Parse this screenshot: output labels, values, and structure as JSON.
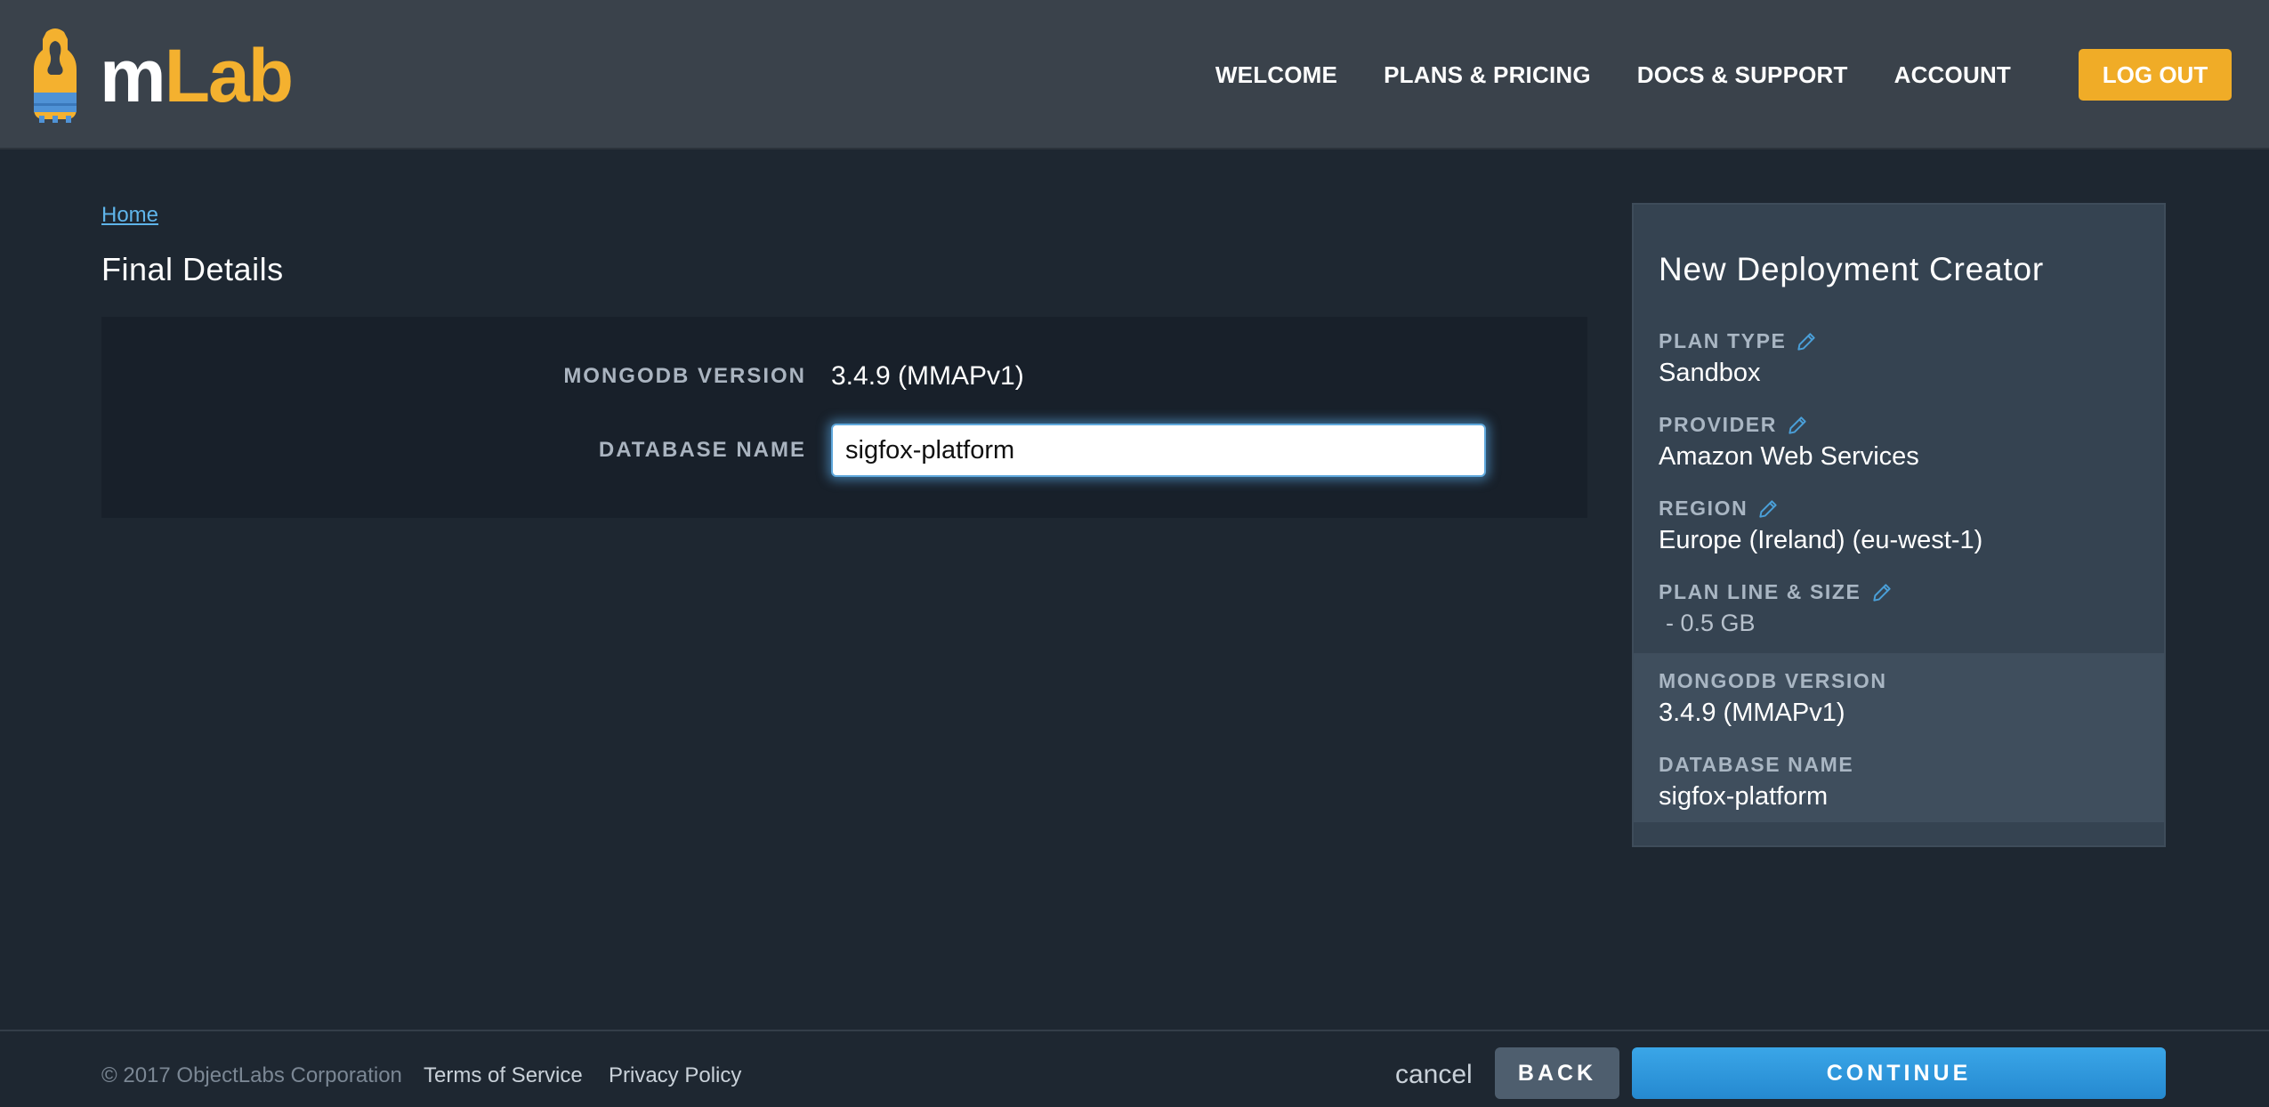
{
  "header": {
    "logo": {
      "text_m": "m",
      "text_lab": "Lab"
    },
    "nav": [
      "WELCOME",
      "PLANS & PRICING",
      "DOCS & SUPPORT",
      "ACCOUNT"
    ],
    "logout_label": "LOG OUT"
  },
  "main": {
    "breadcrumb": "Home",
    "title": "Final Details",
    "form": {
      "mongodb_version_label": "MONGODB VERSION",
      "mongodb_version_value": "3.4.9 (MMAPv1)",
      "database_name_label": "DATABASE NAME",
      "database_name_value": "sigfox-platform"
    }
  },
  "sidebar": {
    "title": "New Deployment Creator",
    "items": [
      {
        "label": "PLAN TYPE",
        "value": "Sandbox",
        "editable": true
      },
      {
        "label": "PROVIDER",
        "value": "Amazon Web Services",
        "editable": true
      },
      {
        "label": "REGION",
        "value": "Europe (Ireland) (eu-west-1)",
        "editable": true
      },
      {
        "label": "PLAN LINE & SIZE",
        "value": " - 0.5 GB",
        "editable": true
      },
      {
        "label": "MONGODB VERSION",
        "value": "3.4.9 (MMAPv1)",
        "editable": false
      },
      {
        "label": "DATABASE NAME",
        "value": "sigfox-platform",
        "editable": false
      }
    ]
  },
  "footer": {
    "copyright": "© 2017 ObjectLabs Corporation",
    "terms": "Terms of Service",
    "privacy": "Privacy Policy",
    "cancel": "cancel",
    "back": "BACK",
    "continue": "CONTINUE"
  },
  "colors": {
    "background": "#1e2731",
    "header": "#3a424b",
    "accent_orange": "#f0ac27",
    "accent_blue": "#2b95dc",
    "link_blue": "#5fb4ea"
  }
}
